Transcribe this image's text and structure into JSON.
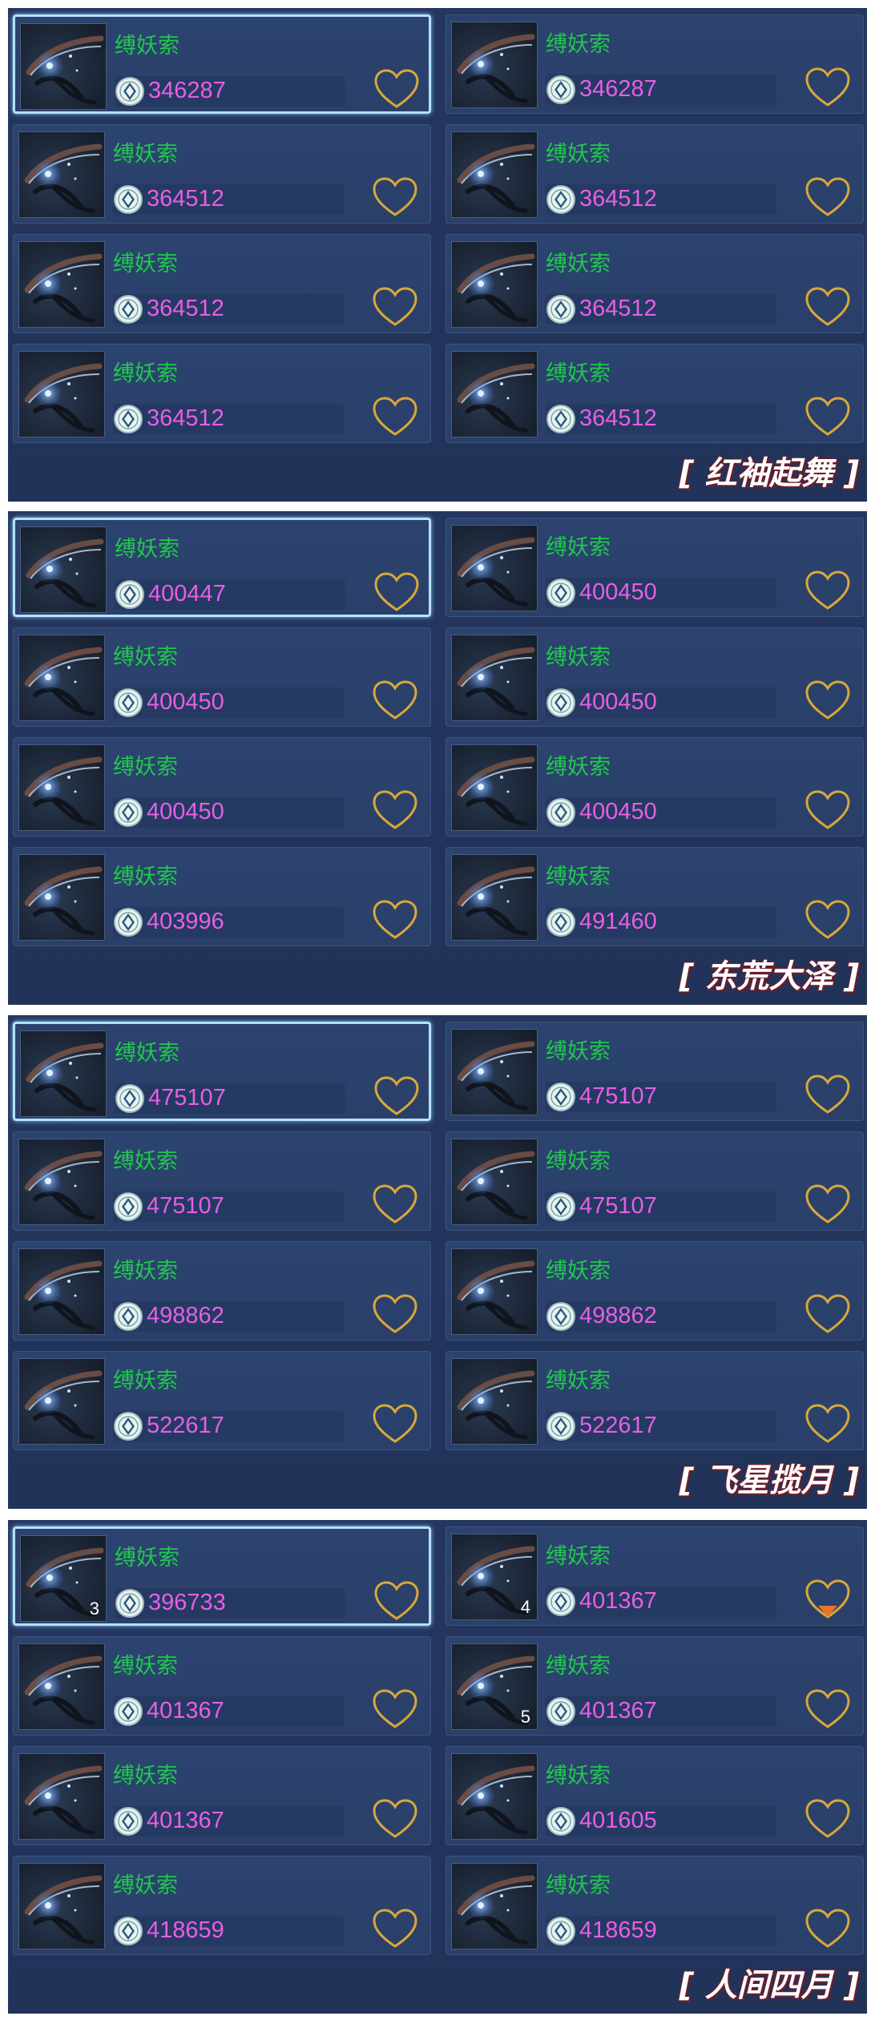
{
  "item_name": "缚妖索",
  "colors": {
    "name": "#1fc84c",
    "price": "#e95ee6",
    "heart": "#d8a83a",
    "heart_filled": "#e8742c"
  },
  "panels": [
    {
      "title": "红袖起舞",
      "cards": [
        {
          "name": "缚妖索",
          "price": "346287",
          "selected": true,
          "count": "",
          "fav": false
        },
        {
          "name": "缚妖索",
          "price": "346287",
          "selected": false,
          "count": "",
          "fav": false
        },
        {
          "name": "缚妖索",
          "price": "364512",
          "selected": false,
          "count": "",
          "fav": false
        },
        {
          "name": "缚妖索",
          "price": "364512",
          "selected": false,
          "count": "",
          "fav": false
        },
        {
          "name": "缚妖索",
          "price": "364512",
          "selected": false,
          "count": "",
          "fav": false
        },
        {
          "name": "缚妖索",
          "price": "364512",
          "selected": false,
          "count": "",
          "fav": false
        },
        {
          "name": "缚妖索",
          "price": "364512",
          "selected": false,
          "count": "",
          "fav": false
        },
        {
          "name": "缚妖索",
          "price": "364512",
          "selected": false,
          "count": "",
          "fav": false
        }
      ]
    },
    {
      "title": "东荒大泽",
      "cards": [
        {
          "name": "缚妖索",
          "price": "400447",
          "selected": true,
          "count": "",
          "fav": false
        },
        {
          "name": "缚妖索",
          "price": "400450",
          "selected": false,
          "count": "",
          "fav": false
        },
        {
          "name": "缚妖索",
          "price": "400450",
          "selected": false,
          "count": "",
          "fav": false
        },
        {
          "name": "缚妖索",
          "price": "400450",
          "selected": false,
          "count": "",
          "fav": false
        },
        {
          "name": "缚妖索",
          "price": "400450",
          "selected": false,
          "count": "",
          "fav": false
        },
        {
          "name": "缚妖索",
          "price": "400450",
          "selected": false,
          "count": "",
          "fav": false
        },
        {
          "name": "缚妖索",
          "price": "403996",
          "selected": false,
          "count": "",
          "fav": false
        },
        {
          "name": "缚妖索",
          "price": "491460",
          "selected": false,
          "count": "",
          "fav": false
        }
      ]
    },
    {
      "title": "飞星揽月",
      "cards": [
        {
          "name": "缚妖索",
          "price": "475107",
          "selected": true,
          "count": "",
          "fav": false
        },
        {
          "name": "缚妖索",
          "price": "475107",
          "selected": false,
          "count": "",
          "fav": false
        },
        {
          "name": "缚妖索",
          "price": "475107",
          "selected": false,
          "count": "",
          "fav": false
        },
        {
          "name": "缚妖索",
          "price": "475107",
          "selected": false,
          "count": "",
          "fav": false
        },
        {
          "name": "缚妖索",
          "price": "498862",
          "selected": false,
          "count": "",
          "fav": false
        },
        {
          "name": "缚妖索",
          "price": "498862",
          "selected": false,
          "count": "",
          "fav": false
        },
        {
          "name": "缚妖索",
          "price": "522617",
          "selected": false,
          "count": "",
          "fav": false
        },
        {
          "name": "缚妖索",
          "price": "522617",
          "selected": false,
          "count": "",
          "fav": false
        }
      ]
    },
    {
      "title": "人间四月",
      "cards": [
        {
          "name": "缚妖索",
          "price": "396733",
          "selected": true,
          "count": "3",
          "fav": false
        },
        {
          "name": "缚妖索",
          "price": "401367",
          "selected": false,
          "count": "4",
          "fav": true
        },
        {
          "name": "缚妖索",
          "price": "401367",
          "selected": false,
          "count": "",
          "fav": false
        },
        {
          "name": "缚妖索",
          "price": "401367",
          "selected": false,
          "count": "5",
          "fav": false
        },
        {
          "name": "缚妖索",
          "price": "401367",
          "selected": false,
          "count": "",
          "fav": false
        },
        {
          "name": "缚妖索",
          "price": "401605",
          "selected": false,
          "count": "",
          "fav": false
        },
        {
          "name": "缚妖索",
          "price": "418659",
          "selected": false,
          "count": "",
          "fav": false
        },
        {
          "name": "缚妖索",
          "price": "418659",
          "selected": false,
          "count": "",
          "fav": false
        }
      ]
    }
  ]
}
